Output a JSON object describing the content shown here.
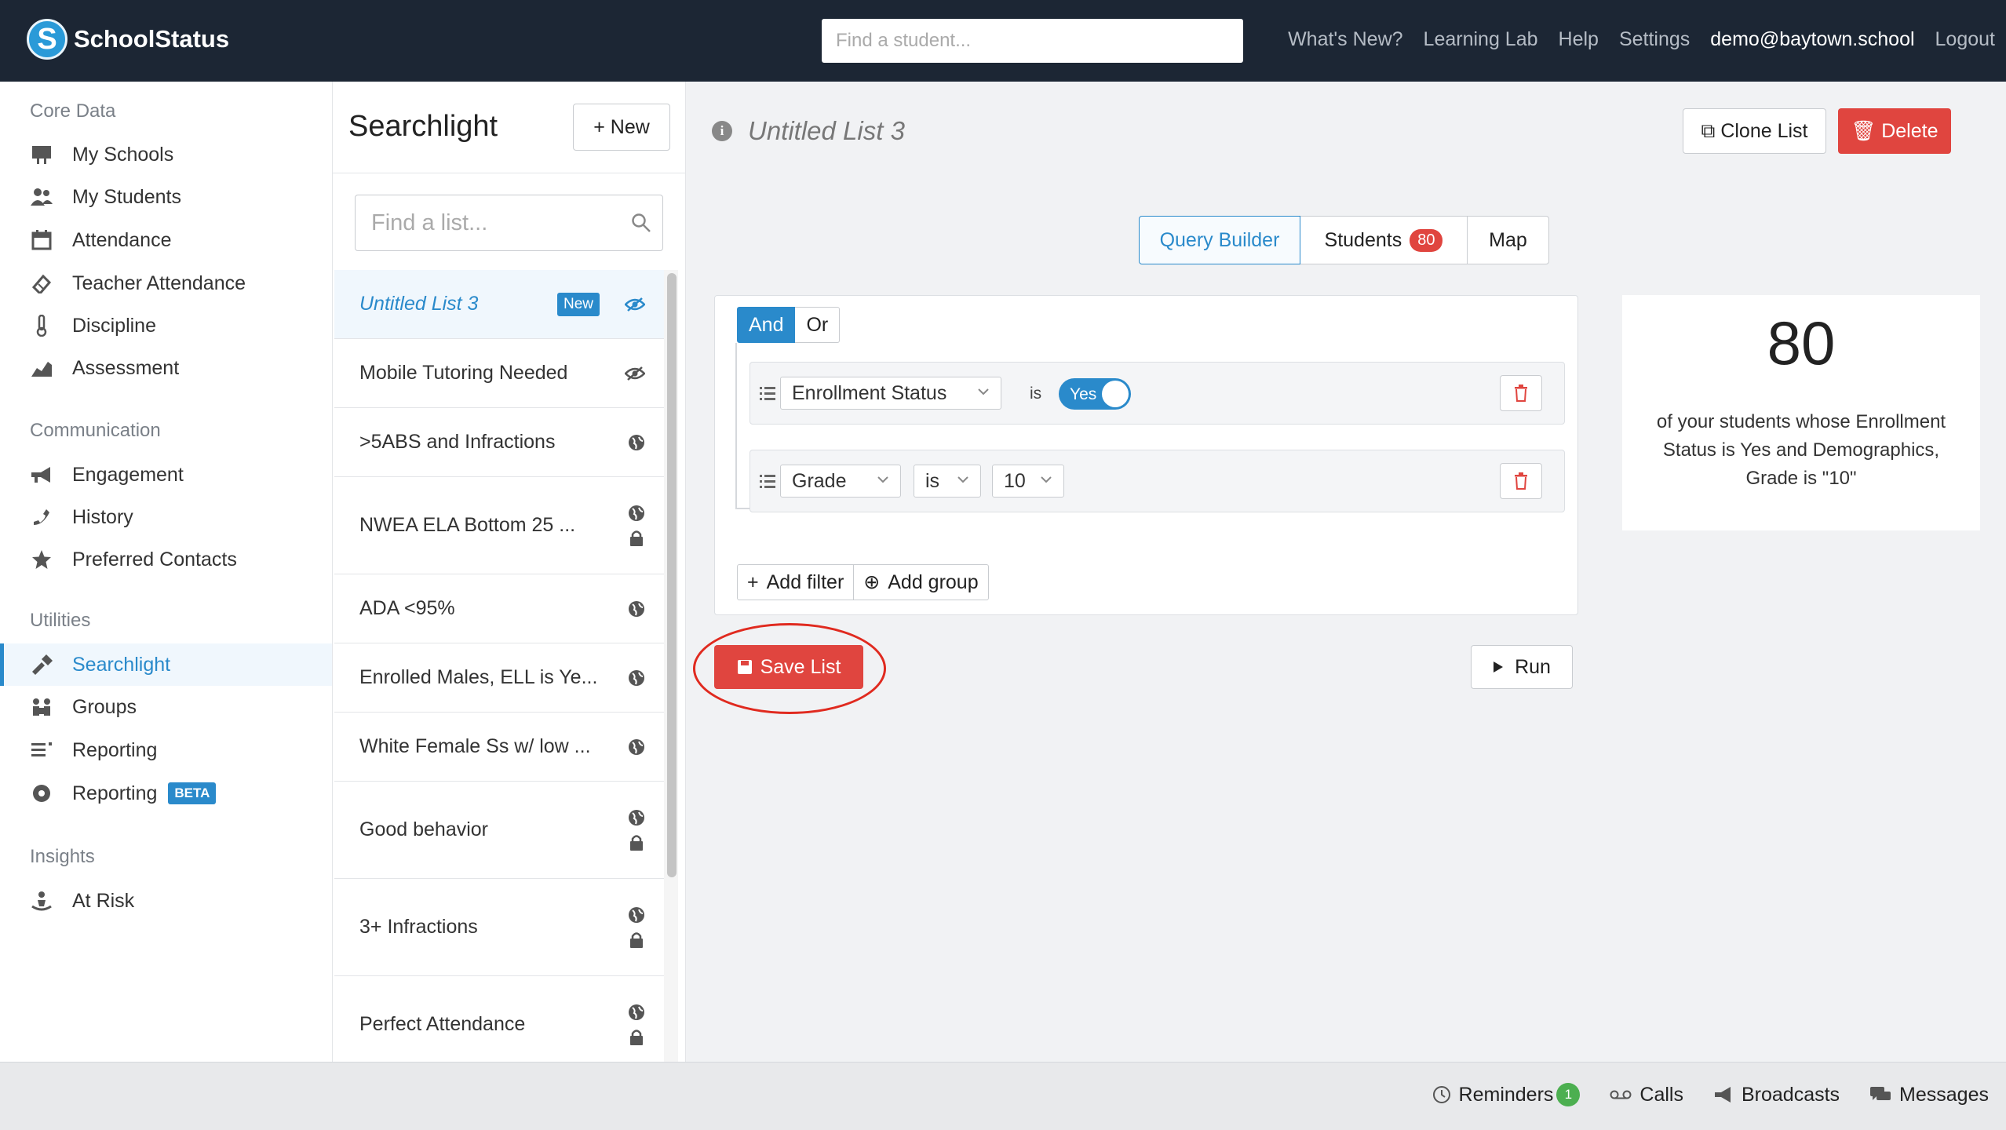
{
  "app": {
    "name": "SchoolStatus"
  },
  "topbar": {
    "search_placeholder": "Find a student...",
    "links": [
      "What's New?",
      "Learning Lab",
      "Help",
      "Settings",
      "demo@baytown.school",
      "Logout"
    ]
  },
  "sidebar": {
    "sections": [
      {
        "title": "Core Data",
        "items": [
          {
            "label": "My Schools",
            "icon": "school-icon"
          },
          {
            "label": "My Students",
            "icon": "students-icon"
          },
          {
            "label": "Attendance",
            "icon": "calendar-icon"
          },
          {
            "label": "Teacher Attendance",
            "icon": "ticket-icon"
          },
          {
            "label": "Discipline",
            "icon": "thermometer-icon"
          },
          {
            "label": "Assessment",
            "icon": "area-chart-icon"
          }
        ]
      },
      {
        "title": "Communication",
        "items": [
          {
            "label": "Engagement",
            "icon": "megaphone-icon"
          },
          {
            "label": "History",
            "icon": "phone-icon"
          },
          {
            "label": "Preferred Contacts",
            "icon": "star-icon"
          }
        ]
      },
      {
        "title": "Utilities",
        "items": [
          {
            "label": "Searchlight",
            "icon": "flashlight-icon",
            "active": true
          },
          {
            "label": "Groups",
            "icon": "groups-icon"
          },
          {
            "label": "Reporting",
            "icon": "list-icon"
          },
          {
            "label": "Reporting",
            "icon": "disc-icon",
            "badge": "BETA"
          }
        ]
      },
      {
        "title": "Insights",
        "items": [
          {
            "label": "At Risk",
            "icon": "at-risk-icon"
          }
        ]
      }
    ]
  },
  "list_panel": {
    "title": "Searchlight",
    "new_button": "New",
    "search_placeholder": "Find a list...",
    "lists": [
      {
        "name": "Untitled List 3",
        "badge": "New",
        "active": true,
        "icons": [
          "eye-slash-icon"
        ]
      },
      {
        "name": "Mobile Tutoring Needed",
        "icons": [
          "eye-slash-icon"
        ]
      },
      {
        "name": ">5ABS and Infractions",
        "icons": [
          "globe-icon"
        ]
      },
      {
        "name": "NWEA ELA Bottom 25 ...",
        "icons": [
          "globe-icon",
          "lock-icon"
        ]
      },
      {
        "name": "ADA <95%",
        "icons": [
          "globe-icon"
        ]
      },
      {
        "name": "Enrolled Males, ELL is Ye...",
        "icons": [
          "globe-icon"
        ]
      },
      {
        "name": "White Female Ss w/ low ...",
        "icons": [
          "globe-icon"
        ]
      },
      {
        "name": "Good behavior",
        "icons": [
          "globe-icon",
          "lock-icon"
        ]
      },
      {
        "name": "3+ Infractions",
        "icons": [
          "globe-icon",
          "lock-icon"
        ]
      },
      {
        "name": "Perfect Attendance",
        "icons": [
          "globe-icon",
          "lock-icon"
        ]
      }
    ]
  },
  "main": {
    "list_title": "Untitled List 3",
    "clone_button": "Clone List",
    "delete_button": "Delete",
    "tabs": [
      {
        "label": "Query Builder",
        "active": true
      },
      {
        "label": "Students",
        "count": "80"
      },
      {
        "label": "Map"
      }
    ],
    "builder": {
      "and_label": "And",
      "or_label": "Or",
      "rules": [
        {
          "field": "Enrollment Status",
          "operator": "is",
          "toggle_value": "Yes"
        },
        {
          "field": "Grade",
          "operator": "is",
          "value": "10"
        }
      ],
      "add_filter": "Add filter",
      "add_group": "Add group"
    },
    "save_button": "Save List",
    "run_button": "Run",
    "summary": {
      "count": "80",
      "text": "of your students whose Enrollment Status is Yes and Demographics, Grade is \"10\""
    }
  },
  "bottombar": {
    "reminders": "Reminders",
    "reminders_count": "1",
    "calls": "Calls",
    "broadcasts": "Broadcasts",
    "messages": "Messages"
  },
  "colors": {
    "topbar_bg": "#1c2634",
    "accent": "#2a8acb",
    "danger": "#e0453f",
    "success": "#4caf50"
  }
}
